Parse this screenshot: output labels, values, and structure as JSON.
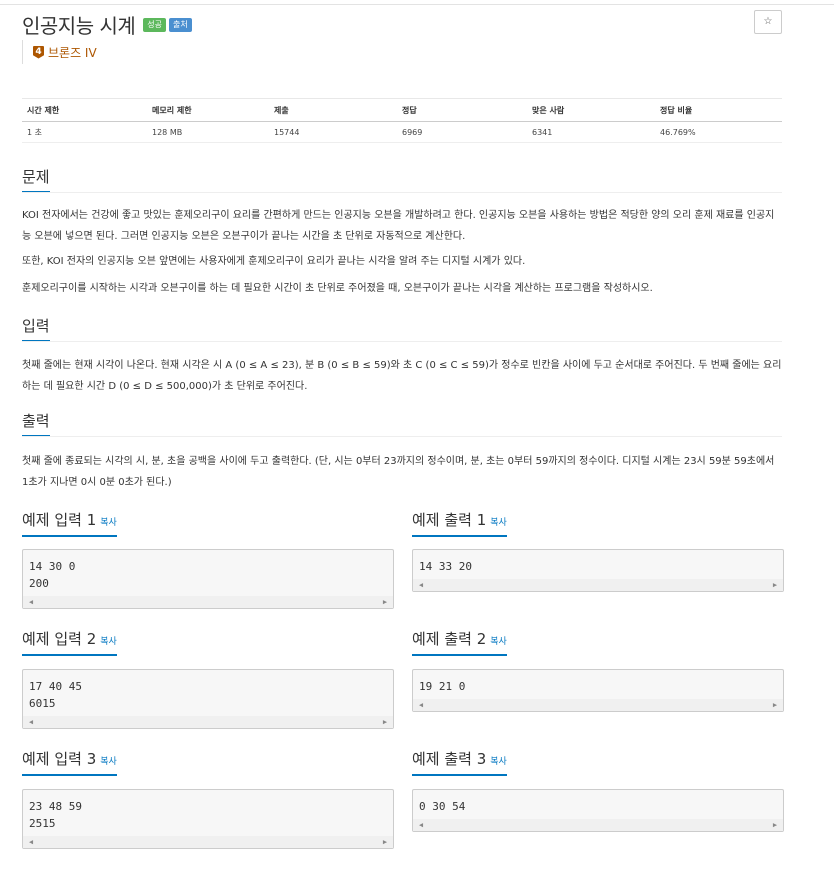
{
  "title": "인공지능 시계",
  "badges": [
    "성공",
    "출처"
  ],
  "star": "☆",
  "tier": {
    "num": "4",
    "label": "브론즈 IV"
  },
  "info": {
    "headers": [
      "시간 제한",
      "메모리 제한",
      "제출",
      "정답",
      "맞은 사람",
      "정답 비율"
    ],
    "values": [
      "1 초",
      "128 MB",
      "15744",
      "6969",
      "6341",
      "46.769%"
    ]
  },
  "sections": {
    "problem": {
      "title": "문제",
      "paras": [
        "KOI 전자에서는 건강에 좋고 맛있는 훈제오리구이 요리를 간편하게 만드는 인공지능 오븐을 개발하려고 한다. 인공지능 오븐을 사용하는 방법은 적당한 양의 오리 훈제 재료를 인공지능 오븐에 넣으면 된다. 그러면 인공지능 오븐은 오븐구이가 끝나는 시간을 초 단위로 자동적으로 계산한다.",
        "또한, KOI 전자의 인공지능 오븐 앞면에는 사용자에게 훈제오리구이 요리가 끝나는 시각을 알려 주는 디지털 시계가 있다.",
        "훈제오리구이를 시작하는 시각과 오븐구이를 하는 데 필요한 시간이 초 단위로 주어졌을 때, 오븐구이가 끝나는 시각을 계산하는 프로그램을 작성하시오."
      ]
    },
    "input": {
      "title": "입력",
      "text": "첫째 줄에는 현재 시각이 나온다. 현재 시각은 시 A (0 ≤ A ≤ 23), 분 B (0 ≤ B ≤ 59)와 초 C (0 ≤ C ≤ 59)가 정수로 빈칸을 사이에 두고 순서대로 주어진다. 두 번째 줄에는 요리하는 데 필요한 시간 D (0 ≤ D ≤ 500,000)가 초 단위로 주어진다."
    },
    "output": {
      "title": "출력",
      "text": "첫째 줄에 종료되는 시각의 시, 분, 초을 공백을 사이에 두고 출력한다. (단, 시는 0부터 23까지의 정수이며, 분, 초는 0부터 59까지의 정수이다. 디지털 시계는 23시 59분 59초에서 1초가 지나면 0시 0분 0초가 된다.)"
    }
  },
  "copy_label": "복사",
  "examples": [
    {
      "in_title": "예제 입력 1",
      "out_title": "예제 출력 1",
      "input": "14 30 0\n200",
      "output": "14 33 20"
    },
    {
      "in_title": "예제 입력 2",
      "out_title": "예제 출력 2",
      "input": "17 40 45\n6015",
      "output": "19 21 0"
    },
    {
      "in_title": "예제 입력 3",
      "out_title": "예제 출력 3",
      "input": "23 48 59\n2515",
      "output": "0 30 54"
    }
  ]
}
